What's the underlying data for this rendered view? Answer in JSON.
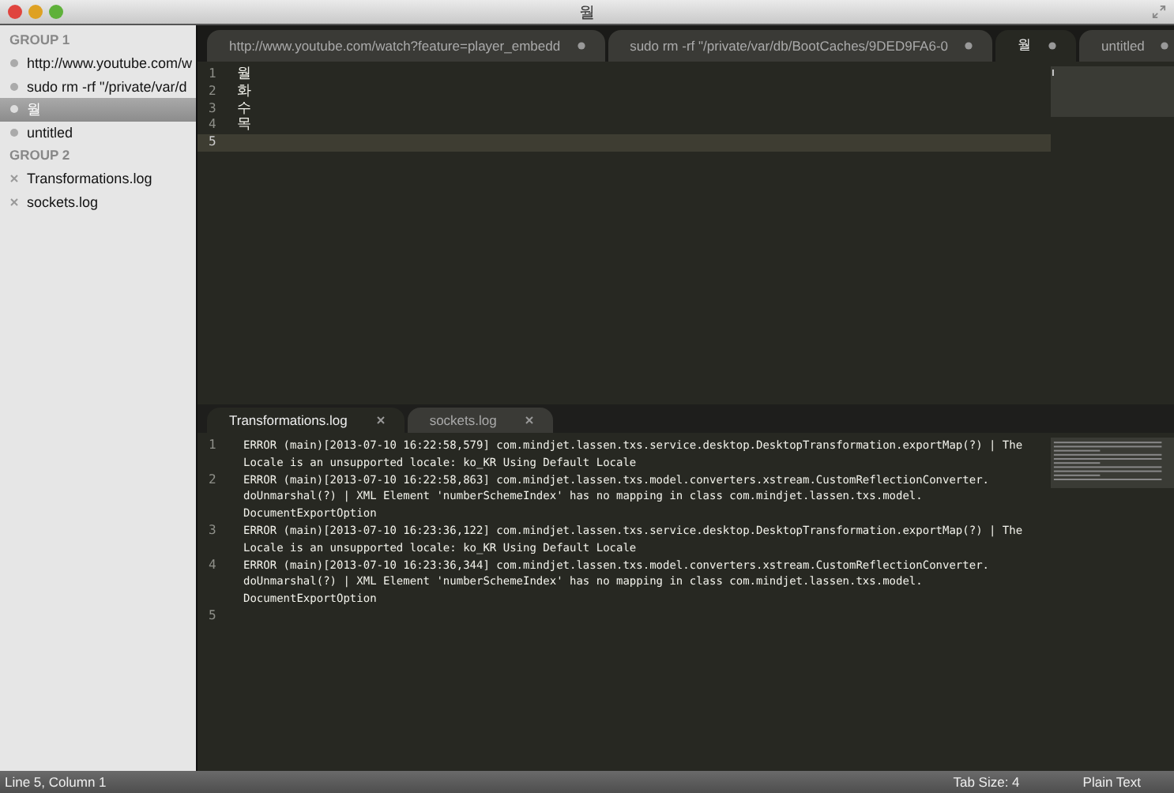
{
  "window": {
    "title": "월"
  },
  "sidebar": {
    "groups": [
      {
        "title": "GROUP 1",
        "items": [
          {
            "label": "http://www.youtube.com/w",
            "kind": "dot",
            "selected": false
          },
          {
            "label": "sudo rm -rf \"/private/var/d",
            "kind": "dot",
            "selected": false
          },
          {
            "label": "월",
            "kind": "dot",
            "selected": true
          },
          {
            "label": "untitled",
            "kind": "dot",
            "selected": false
          }
        ]
      },
      {
        "title": "GROUP 2",
        "items": [
          {
            "label": "Transformations.log",
            "kind": "close",
            "selected": false
          },
          {
            "label": "sockets.log",
            "kind": "close",
            "selected": false
          }
        ]
      }
    ]
  },
  "top_pane": {
    "tabs": [
      {
        "label": "http://www.youtube.com/watch?feature=player_embedd",
        "kind": "dot",
        "selected": false
      },
      {
        "label": "sudo rm -rf \"/private/var/db/BootCaches/9DED9FA6-0",
        "kind": "dot",
        "selected": false
      },
      {
        "label": "월",
        "kind": "dot",
        "selected": true
      },
      {
        "label": "untitled",
        "kind": "dot",
        "selected": false
      }
    ],
    "lines": [
      {
        "number": "1",
        "text": [
          "월"
        ],
        "current": false
      },
      {
        "number": "2",
        "text": [
          "화"
        ],
        "current": false
      },
      {
        "number": "3",
        "text": [
          "수"
        ],
        "current": false
      },
      {
        "number": "4",
        "text": [
          "목"
        ],
        "current": false
      },
      {
        "number": "5",
        "current": true
      }
    ]
  },
  "bottom_pane": {
    "tabs": [
      {
        "label": "Transformations.log",
        "kind": "close",
        "selected": true
      },
      {
        "label": "sockets.log",
        "kind": "close",
        "selected": false
      }
    ],
    "lines": [
      {
        "number": "1",
        "text": [
          "ERROR (main)[2013-07-10 16:22:58,579] com.mindjet.lassen.txs.service.desktop.DesktopTransformation.exportMap(?) | The",
          "Locale is an unsupported locale: ko_KR Using Default Locale"
        ],
        "current": false
      },
      {
        "number": "2",
        "text": [
          "ERROR (main)[2013-07-10 16:22:58,863] com.mindjet.lassen.txs.model.converters.xstream.CustomReflectionConverter.",
          "doUnmarshal(?) | XML Element 'numberSchemeIndex' has no mapping in class com.mindjet.lassen.txs.model.",
          "DocumentExportOption"
        ],
        "current": false
      },
      {
        "number": "3",
        "text": [
          "ERROR (main)[2013-07-10 16:23:36,122] com.mindjet.lassen.txs.service.desktop.DesktopTransformation.exportMap(?) | The",
          "Locale is an unsupported locale: ko_KR Using Default Locale"
        ],
        "current": false
      },
      {
        "number": "4",
        "text": [
          "ERROR (main)[2013-07-10 16:23:36,344] com.mindjet.lassen.txs.model.converters.xstream.CustomReflectionConverter.",
          "doUnmarshal(?) | XML Element 'numberSchemeIndex' has no mapping in class com.mindjet.lassen.txs.model.",
          "DocumentExportOption"
        ],
        "current": false
      },
      {
        "number": "5",
        "current": false
      }
    ]
  },
  "status_bar": {
    "position": "Line 5, Column 1",
    "tab_size": "Tab Size: 4",
    "syntax": "Plain Text"
  }
}
